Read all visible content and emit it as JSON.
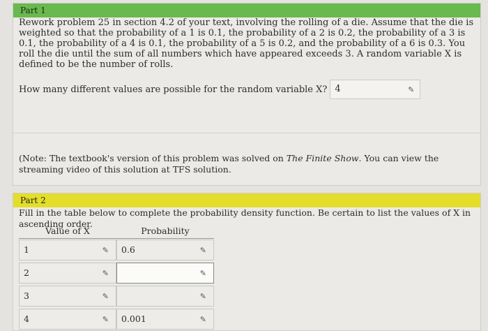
{
  "part1": {
    "header": "Part 1",
    "problem": "Rework problem 25 in section 4.2 of your text, involving the rolling of a die. Assume that the die is weighted so that the probability of a 1 is 0.1, the probability of a 2 is 0.2, the probability of a 3 is 0.1, the probability of a 4 is 0.1, the probability of a 5 is 0.2, and the probability of a 6 is 0.3. You roll the die until the sum of all numbers which have appeared exceeds 3. A random variable X is defined to be the number of rolls.",
    "question": "How many different values are possible for the random variable X?",
    "answer": "4",
    "note_prefix": "(Note: The textbook's version of this problem was solved on ",
    "note_italic": "The Finite Show",
    "note_suffix": ". You can view the streaming video of this solution at TFS solution."
  },
  "part2": {
    "header": "Part 2",
    "instruction": "Fill in the table below to complete the probability density function. Be certain to list the values of X in ascending order.",
    "columns": [
      "Value of X",
      "Probability"
    ],
    "rows": [
      {
        "x": "1",
        "p": "0.6"
      },
      {
        "x": "2",
        "p": ""
      },
      {
        "x": "3",
        "p": ""
      },
      {
        "x": "4",
        "p": "0.001"
      }
    ]
  },
  "icons": {
    "edit": "pencil-icon"
  },
  "colors": {
    "part1_header": "#69b94f",
    "part2_header": "#e4dd2b"
  }
}
